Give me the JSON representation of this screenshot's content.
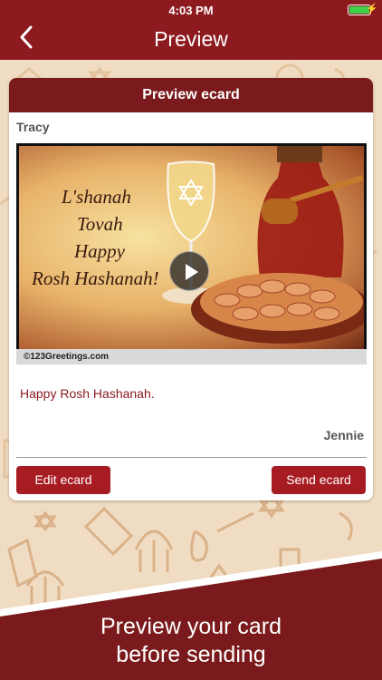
{
  "status_bar": {
    "time": "4:03 PM",
    "battery_level": 1.0
  },
  "nav": {
    "back_icon": "chevron-left-icon",
    "title": "Preview"
  },
  "card": {
    "header_title": "Preview ecard",
    "recipient": "Tracy",
    "ecard_image": {
      "greeting_lines": [
        "L'shanah",
        "Tovah",
        "Happy",
        "Rosh Hashanah!"
      ],
      "caption": "©123Greetings.com",
      "play_icon": "play-icon"
    },
    "message": "Happy Rosh Hashanah.",
    "sender": "Jennie",
    "edit_label": "Edit ecard",
    "send_label": "Send ecard"
  },
  "footer": {
    "line1": "Preview your card",
    "line2": "before sending"
  },
  "colors": {
    "primary": "#8c1a1f",
    "button": "#a71c22",
    "background": "#f0dcc2",
    "message_text": "#8b1a1f"
  }
}
